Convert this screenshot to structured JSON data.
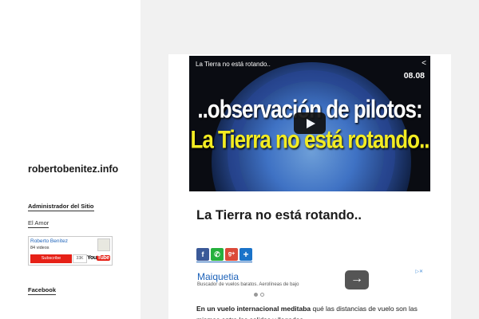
{
  "sidebar": {
    "site_title": "robertobenitez.info",
    "admin_title": "Administrador del Sitio",
    "link_el_amor": "El Amor",
    "youtube_widget": {
      "channel_name": "Roberto Benítez",
      "video_count": "84 videos",
      "subscribe_label": "Subscribe",
      "subscriber_count": "33K",
      "logo_you": "You",
      "logo_tube": "Tube"
    },
    "facebook_title": "Facebook"
  },
  "post": {
    "video": {
      "title": "La Tierra no está rotando..",
      "time": "08.08",
      "line1": "..observación de pilotos:",
      "line2": "La Tierra no está rotando.."
    },
    "title": "La Tierra no está rotando..",
    "share_icons": [
      "facebook-icon",
      "whatsapp-icon",
      "google-plus-icon",
      "add-share-icon"
    ],
    "ad": {
      "title": "Maiquetia",
      "description": "Buscador de vuelos baratos. Aerolíneas de bajo",
      "button_glyph": "→"
    },
    "body_bold": "En un vuelo internacional meditaba",
    "body_rest": " qué las distancias de vuelo son las mismas entre las salidas y llegadas"
  }
}
